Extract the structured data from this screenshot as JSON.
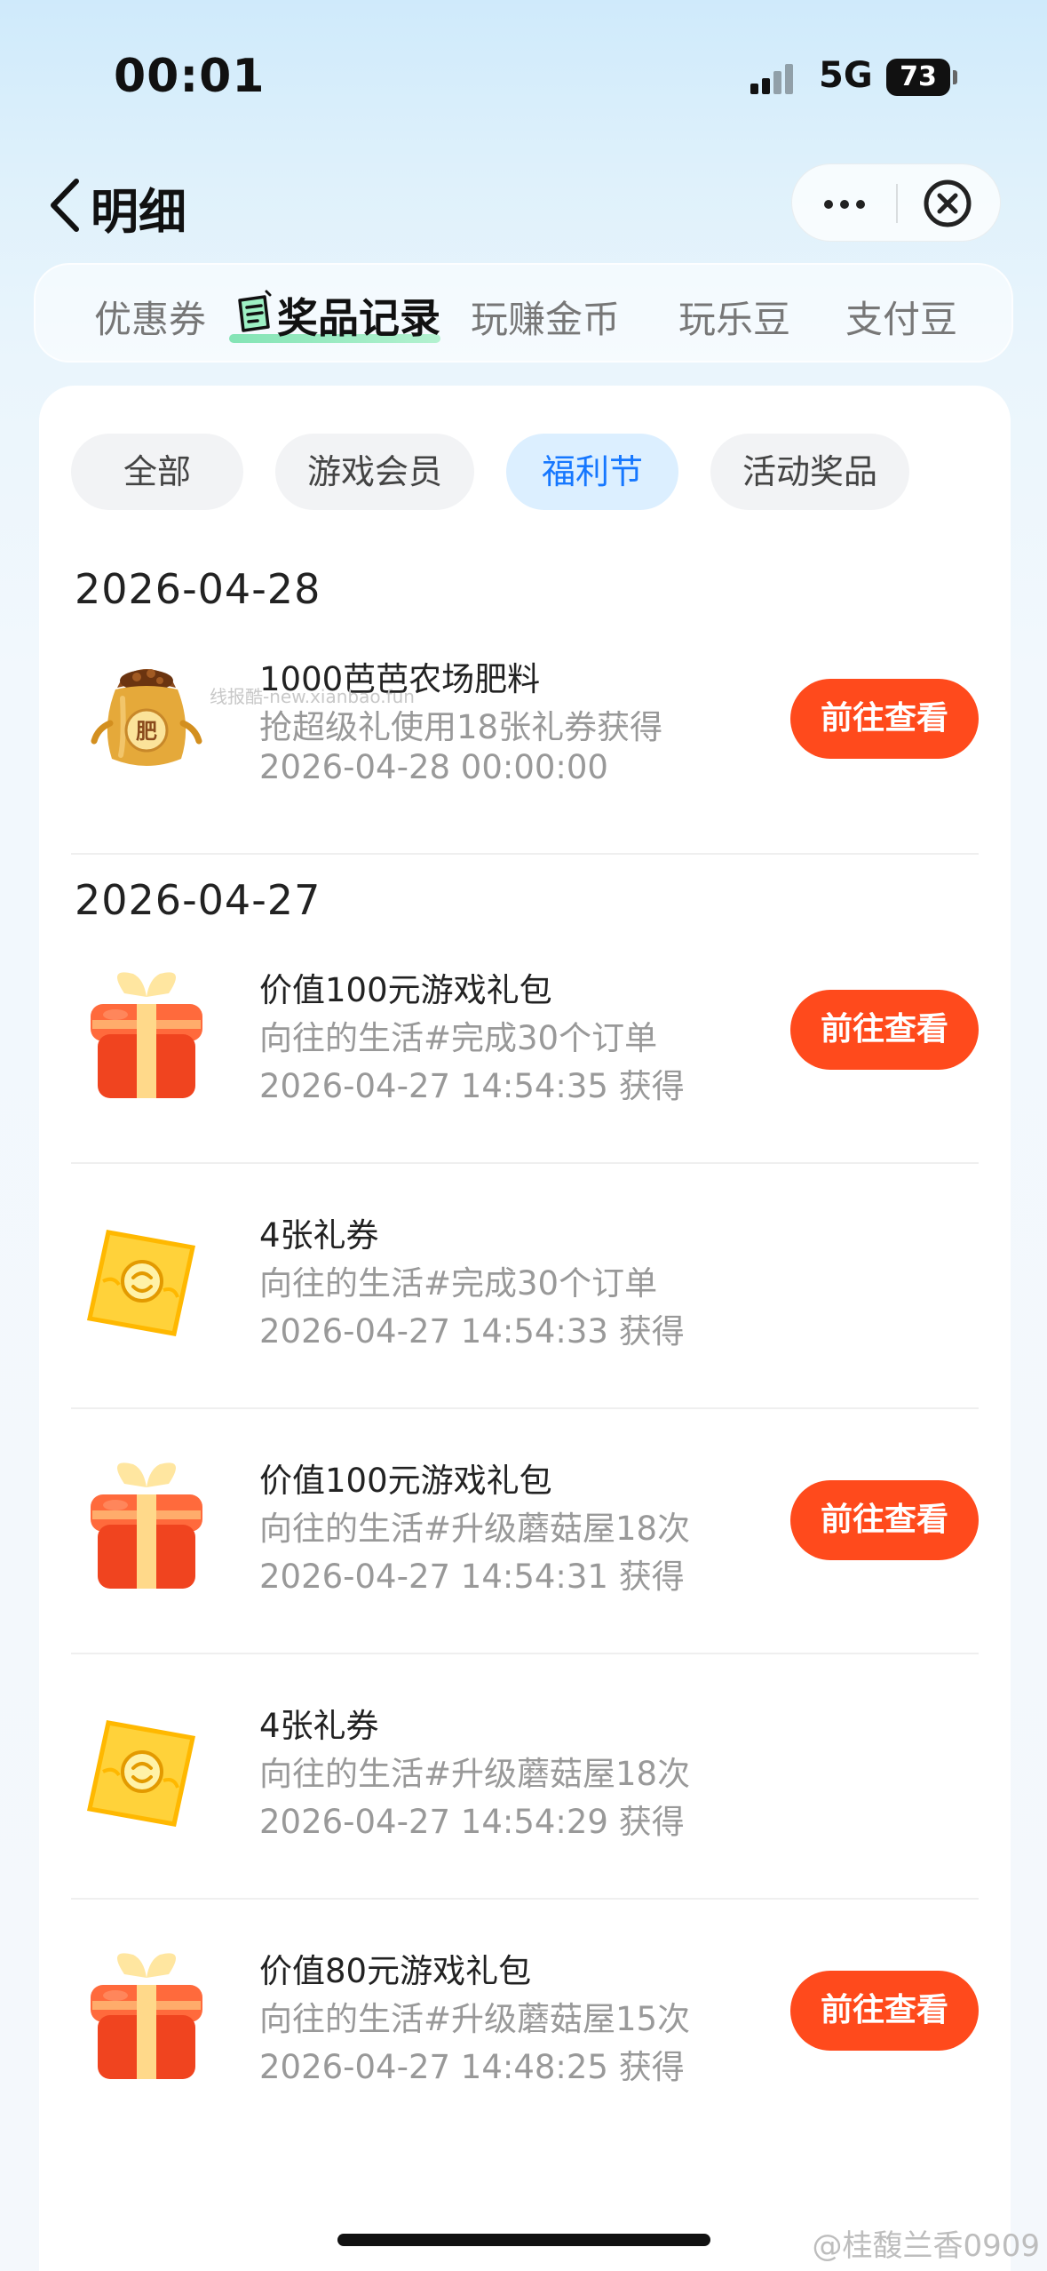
{
  "status_bar": {
    "time": "00:01",
    "network": "5G",
    "battery": "73"
  },
  "nav": {
    "title": "明细"
  },
  "main_tabs": [
    {
      "label": "优惠券",
      "active": false
    },
    {
      "label": "奖品记录",
      "active": true
    },
    {
      "label": "玩赚金币",
      "active": false
    },
    {
      "label": "玩乐豆",
      "active": false
    },
    {
      "label": "支付豆",
      "active": false
    }
  ],
  "filters": [
    {
      "label": "全部",
      "active": false
    },
    {
      "label": "游戏会员",
      "active": false
    },
    {
      "label": "福利节",
      "active": true
    },
    {
      "label": "活动奖品",
      "active": false
    }
  ],
  "groups": [
    {
      "date": "2026-04-28",
      "items": [
        {
          "icon": "fertilizer-bag-icon",
          "title": "1000芭芭农场肥料",
          "source": "抢超级礼使用18张礼券获得",
          "time": "2026-04-28 00:00:00",
          "button": "前往查看"
        }
      ]
    },
    {
      "date": "2026-04-27",
      "items": [
        {
          "icon": "gift-box-icon",
          "title": "价值100元游戏礼包",
          "source": "向往的生活#完成30个订单",
          "time": "2026-04-27 14:54:35 获得",
          "button": "前往查看"
        },
        {
          "icon": "coupon-ticket-icon",
          "title": "4张礼券",
          "source": "向往的生活#完成30个订单",
          "time": "2026-04-27 14:54:33 获得",
          "button": ""
        },
        {
          "icon": "gift-box-icon",
          "title": "价值100元游戏礼包",
          "source": "向往的生活#升级蘑菇屋18次",
          "time": "2026-04-27 14:54:31 获得",
          "button": "前往查看"
        },
        {
          "icon": "coupon-ticket-icon",
          "title": "4张礼券",
          "source": "向往的生活#升级蘑菇屋18次",
          "time": "2026-04-27 14:54:29 获得",
          "button": ""
        },
        {
          "icon": "gift-box-icon",
          "title": "价值80元游戏礼包",
          "source": "向往的生活#升级蘑菇屋15次",
          "time": "2026-04-27 14:48:25 获得",
          "button": "前往查看"
        }
      ]
    }
  ],
  "watermark_small": "线报酷-new.xianbao.fun",
  "watermark": "@桂馥兰香0909",
  "colors": {
    "accent_button": "#ff4a1c",
    "filter_active_text": "#1677ff",
    "filter_active_bg": "#dcefff"
  }
}
